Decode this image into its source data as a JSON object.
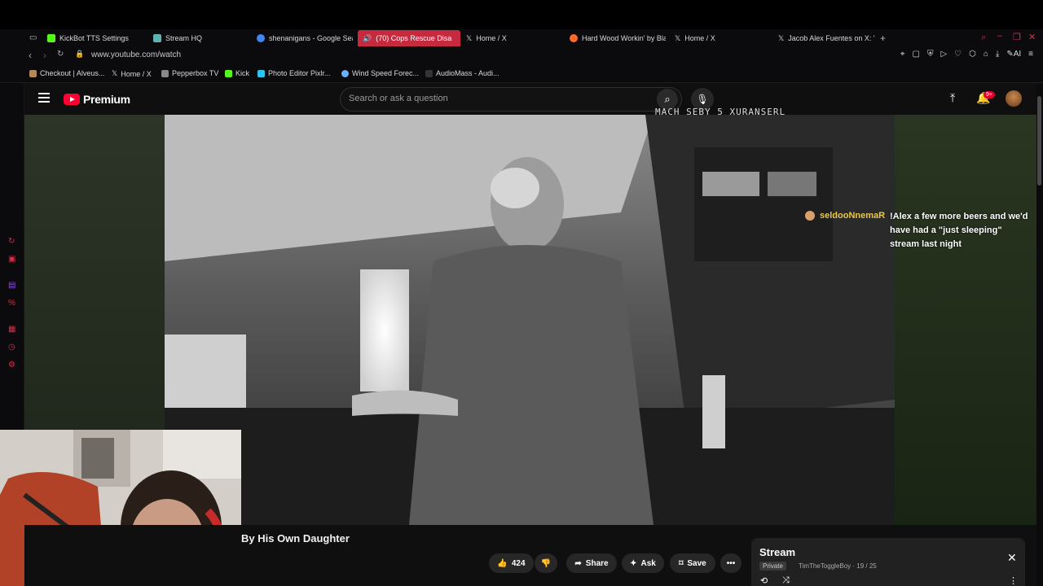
{
  "browser": {
    "tabs": [
      {
        "label": "KickBot TTS Settings",
        "color": "#53fc18"
      },
      {
        "label": "Stream HQ",
        "color": "#5fb3b3"
      },
      {
        "label": "shenanigans - Google Sear",
        "color": "#4285f4"
      },
      {
        "label": "(70) Cops Rescue Disa",
        "color": "#ffffff",
        "active": true
      },
      {
        "label": "Home / X",
        "color": "#ffffff"
      },
      {
        "label": "Hard Wood Workin' by Blan",
        "color": "#ff6a2b"
      },
      {
        "label": "Home / X",
        "color": "#ffffff"
      },
      {
        "label": "Jacob Alex Fuentes on X: \"",
        "color": "#ffffff"
      }
    ],
    "url": "www.youtube.com/watch",
    "bookmarks": [
      {
        "label": "Checkout | Alveus...",
        "color": "#b58a5a"
      },
      {
        "label": "Home / X",
        "color": "#ffffff"
      },
      {
        "label": "Pepperbox TV",
        "color": "#888888"
      },
      {
        "label": "Kick",
        "color": "#53fc18"
      },
      {
        "label": "Photo Editor Pixlr...",
        "color": "#2ec4f0"
      },
      {
        "label": "Wind Speed Forec...",
        "color": "#6ab0ff"
      },
      {
        "label": "AudioMass - Audi...",
        "color": "#333333"
      }
    ]
  },
  "youtube": {
    "logo": "Premium",
    "search_placeholder": "Search or ask a question",
    "notification_count": "9+"
  },
  "video": {
    "overlay_text": "MACH SEBY 5 XURANSERL",
    "chat": {
      "username": "seldooNnemaR",
      "message": "!Alex a few more beers and we'd have had a \"just sleeping\" stream last night"
    },
    "title": "By His Own Daughter"
  },
  "actions": {
    "like_count": "424",
    "share": "Share",
    "ask": "Ask",
    "save": "Save"
  },
  "playlist": {
    "title": "Stream",
    "privacy": "Private",
    "owner_progress": "TimTheToggleBoy · 19 / 25"
  }
}
